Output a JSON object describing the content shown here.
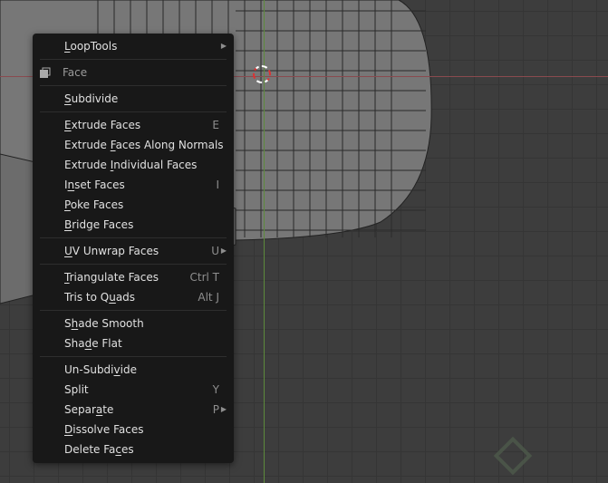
{
  "menu": {
    "items": [
      {
        "type": "item",
        "label": "LoopTools",
        "u": 0,
        "submenu": true
      },
      {
        "type": "sep"
      },
      {
        "type": "title",
        "label": "Face",
        "icon": "face-select-icon"
      },
      {
        "type": "sep"
      },
      {
        "type": "item",
        "label": "Subdivide",
        "u": 0
      },
      {
        "type": "sep"
      },
      {
        "type": "item",
        "label": "Extrude Faces",
        "u": 0,
        "shortcut": "E"
      },
      {
        "type": "item",
        "label": "Extrude Faces Along Normals",
        "u": 8
      },
      {
        "type": "item",
        "label": "Extrude Individual Faces",
        "u": 8
      },
      {
        "type": "item",
        "label": "Inset Faces",
        "u": 1,
        "shortcut": "I"
      },
      {
        "type": "item",
        "label": "Poke Faces",
        "u": 0
      },
      {
        "type": "item",
        "label": "Bridge Faces",
        "u": 0
      },
      {
        "type": "sep"
      },
      {
        "type": "item",
        "label": "UV Unwrap Faces",
        "u": 0,
        "shortcut": "U",
        "submenu": true
      },
      {
        "type": "sep"
      },
      {
        "type": "item",
        "label": "Triangulate Faces",
        "u": 0,
        "shortcut": "Ctrl T"
      },
      {
        "type": "item",
        "label": "Tris to Quads",
        "u": 9,
        "shortcut": "Alt J"
      },
      {
        "type": "sep"
      },
      {
        "type": "item",
        "label": "Shade Smooth",
        "u": 1
      },
      {
        "type": "item",
        "label": "Shade Flat",
        "u": 3
      },
      {
        "type": "sep"
      },
      {
        "type": "item",
        "label": "Un-Subdivide",
        "u": 8
      },
      {
        "type": "item",
        "label": "Split",
        "u": -1,
        "shortcut": "Y"
      },
      {
        "type": "item",
        "label": "Separate",
        "u": 5,
        "shortcut": "P",
        "submenu": true
      },
      {
        "type": "item",
        "label": "Dissolve Faces",
        "u": 0
      },
      {
        "type": "item",
        "label": "Delete Faces",
        "u": 9
      }
    ]
  }
}
